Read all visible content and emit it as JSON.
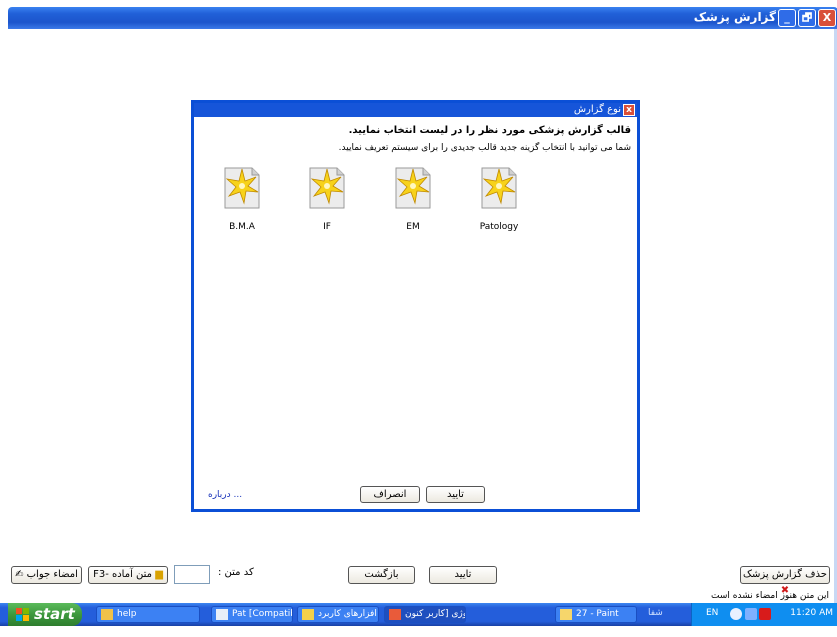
{
  "window": {
    "title": "گزارش پزشک",
    "buttons": {
      "min": "_",
      "max": "🗗",
      "close": "X"
    }
  },
  "dialog": {
    "title": "نوع گزارش",
    "heading": "قالب گزارش پزشکی مورد نظر را در لیست انتخاب نمایید.",
    "subtext": "شما می توانید با انتخاب گزینه جدید قالب جدیدی را برای سیستم تعریف نمایید.",
    "templates": [
      {
        "label": "B.M.A",
        "icon": "template-star-icon"
      },
      {
        "label": "IF",
        "icon": "template-star-icon"
      },
      {
        "label": "EM",
        "icon": "template-star-icon"
      },
      {
        "label": "Patology",
        "icon": "template-star-icon"
      }
    ],
    "about_link": "درباره ...",
    "cancel_label": "انصراف",
    "ok_label": "تایید"
  },
  "toolbar": {
    "sign_answer": "امضاء جواب",
    "ready_text": "F3- متن آماده",
    "code_label": "کد متن :",
    "code_value": "",
    "back": "بازگشت",
    "confirm": "تایید",
    "delete_report": "حذف گزارش پزشک",
    "status": "این متن هنوز امضاء نشده است"
  },
  "taskbar": {
    "start": "start",
    "tasks": [
      {
        "label": "help"
      },
      {
        "label": "Pat [Compatibility ..."
      },
      {
        "label": "نرم افزارهای کاربرد..."
      },
      {
        "label": "پاتولوژی [کاربر کنون..."
      },
      {
        "label": "27 - Paint"
      }
    ],
    "hint": "شفا",
    "lang": "EN",
    "clock": "11:20 AM"
  },
  "colors": {
    "titlebar": "#245edb",
    "dialog_border": "#0b4fd6",
    "start_green": "#3d983d",
    "tray": "#0f8ef0"
  }
}
